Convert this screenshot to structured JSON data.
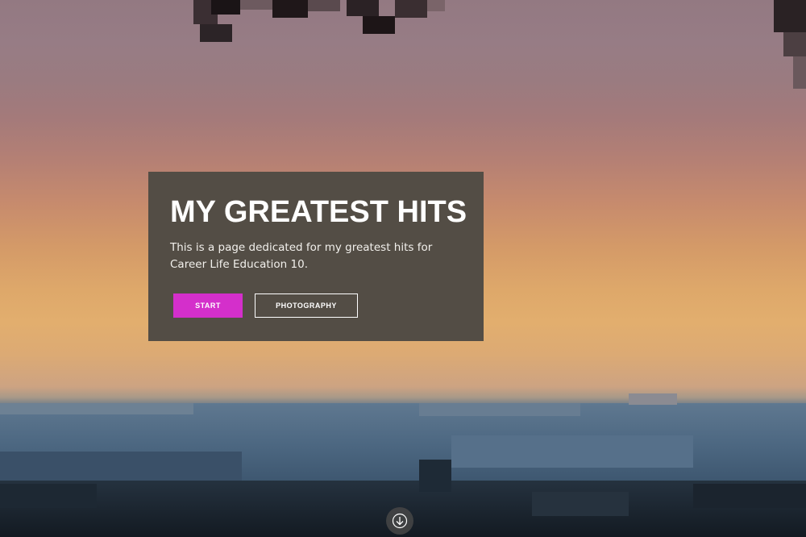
{
  "hero": {
    "title": "MY GREATEST HITS",
    "description": "This is a page dedicated for my greatest hits for Career Life Education 10.",
    "start_label": "START",
    "photography_label": "PHOTOGRAPHY",
    "scroll_icon": "arrow-down-icon"
  },
  "colors": {
    "panel": "#534d45",
    "accent": "#d42fcb",
    "text": "#ffffff"
  }
}
